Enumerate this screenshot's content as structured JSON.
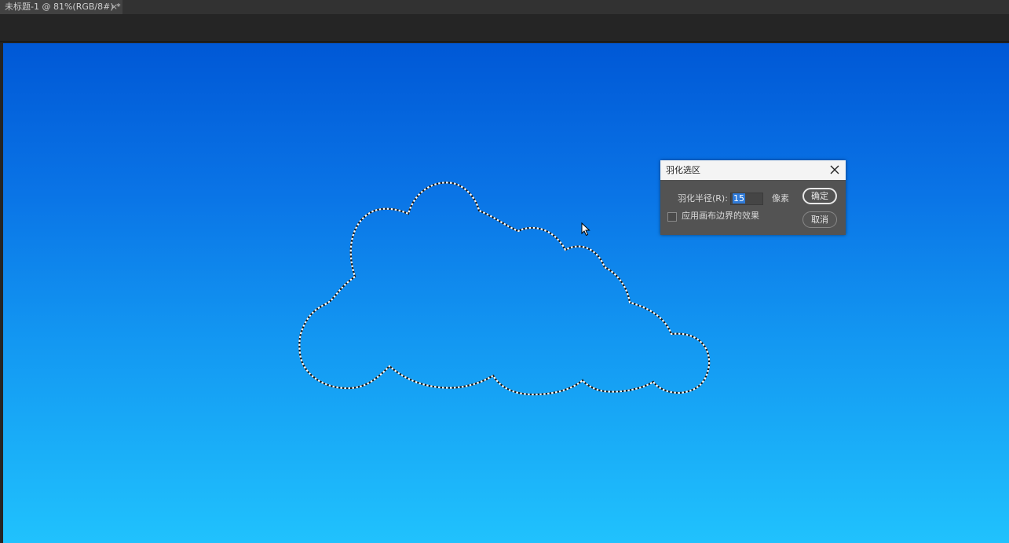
{
  "document_tab": {
    "title": "未标题-1 @ 81%(RGB/8#) *",
    "close_glyph": "×"
  },
  "canvas": {
    "gradient_top": "#0058d6",
    "gradient_bottom": "#20c2fd",
    "selection": "cloud-marquee"
  },
  "dialog": {
    "title": "羽化选区",
    "radius_label": "羽化半径(R):",
    "radius_value": "15",
    "unit_label": "像素",
    "checkbox_label": "应用画布边界的效果",
    "checkbox_checked": false,
    "ok_label": "确定",
    "cancel_label": "取消"
  },
  "icons": {
    "close": "close-icon",
    "cursor": "mouse-pointer-icon"
  }
}
